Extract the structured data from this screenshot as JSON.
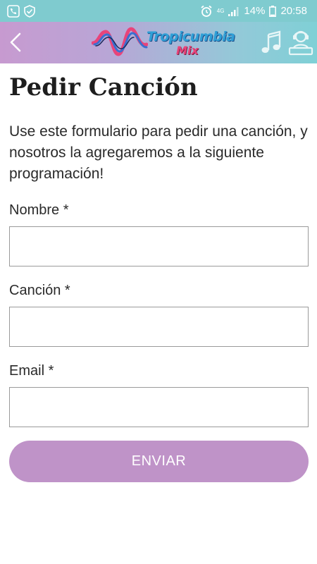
{
  "status_bar": {
    "network": "4G",
    "battery": "14%",
    "time": "20:58"
  },
  "app_bar": {
    "logo_line1": "Tropicumbia",
    "logo_line2": "Mix"
  },
  "page": {
    "title": "Pedir Canción",
    "intro": "Use este formulario para pedir una canción, y nosotros la agregaremos a la siguiente programación!"
  },
  "form": {
    "fields": [
      {
        "label": "Nombre *",
        "value": ""
      },
      {
        "label": "Canción *",
        "value": ""
      },
      {
        "label": "Email *",
        "value": ""
      }
    ],
    "submit_label": "ENVIAR"
  },
  "colors": {
    "status_bar": "#7fcbcf",
    "button": "#bf93c8",
    "logo_blue": "#2f9fd6",
    "logo_pink": "#e8447a"
  }
}
